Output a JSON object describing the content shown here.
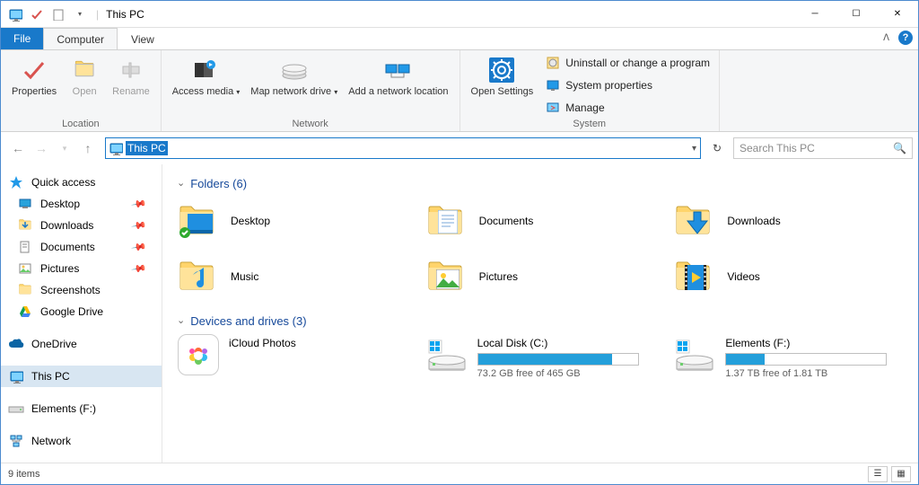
{
  "titlebar": {
    "title": "This PC",
    "qat": [
      "monitor-icon",
      "check-icon",
      "doc-icon"
    ]
  },
  "ribbon_tabs": {
    "file": "File",
    "computer": "Computer",
    "view": "View"
  },
  "ribbon": {
    "location": {
      "label": "Location",
      "properties": "Properties",
      "open": "Open",
      "rename": "Rename"
    },
    "network": {
      "label": "Network",
      "access_media": "Access media",
      "map_drive": "Map network drive",
      "add_location": "Add a network location"
    },
    "system": {
      "label": "System",
      "open_settings": "Open Settings",
      "uninstall": "Uninstall or change a program",
      "sys_props": "System properties",
      "manage": "Manage"
    }
  },
  "address": {
    "text": "This PC"
  },
  "search": {
    "placeholder": "Search This PC"
  },
  "sidebar": {
    "quick_access": "Quick access",
    "quick_items": [
      {
        "label": "Desktop",
        "pinned": true,
        "icon": "desktop"
      },
      {
        "label": "Downloads",
        "pinned": true,
        "icon": "downloads"
      },
      {
        "label": "Documents",
        "pinned": true,
        "icon": "documents"
      },
      {
        "label": "Pictures",
        "pinned": true,
        "icon": "pictures"
      },
      {
        "label": "Screenshots",
        "pinned": false,
        "icon": "folder"
      },
      {
        "label": "Google Drive",
        "pinned": false,
        "icon": "gdrive"
      }
    ],
    "onedrive": "OneDrive",
    "this_pc": "This PC",
    "elements": "Elements (F:)",
    "network": "Network"
  },
  "sections": {
    "folders_header": "Folders (6)",
    "folders": [
      {
        "label": "Desktop",
        "icon": "desktop"
      },
      {
        "label": "Documents",
        "icon": "documents"
      },
      {
        "label": "Downloads",
        "icon": "downloads"
      },
      {
        "label": "Music",
        "icon": "music"
      },
      {
        "label": "Pictures",
        "icon": "pictures"
      },
      {
        "label": "Videos",
        "icon": "videos"
      }
    ],
    "drives_header": "Devices and drives (3)",
    "drives": [
      {
        "label": "iCloud Photos",
        "type": "icloud"
      },
      {
        "label": "Local Disk (C:)",
        "type": "hdd",
        "free": "73.2 GB free of 465 GB",
        "used_pct": 84
      },
      {
        "label": "Elements (F:)",
        "type": "hdd",
        "free": "1.37 TB free of 1.81 TB",
        "used_pct": 24
      }
    ]
  },
  "status": {
    "text": "9 items"
  }
}
